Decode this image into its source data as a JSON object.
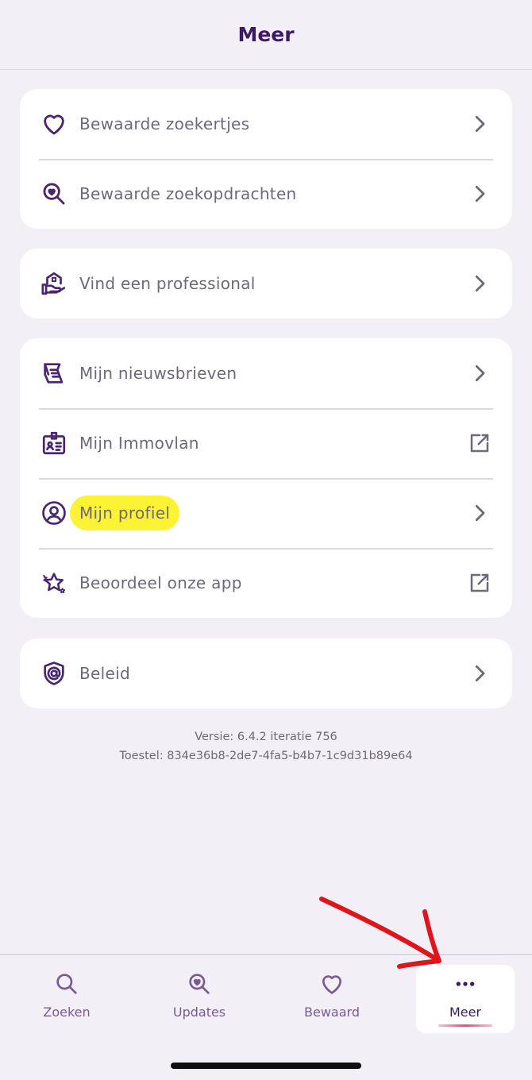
{
  "header": {
    "title": "Meer"
  },
  "menu": {
    "group1": [
      {
        "label": "Bewaarde zoekertjes",
        "icon": "heart-icon",
        "trail": "chevron-right-icon"
      },
      {
        "label": "Bewaarde zoekopdrachten",
        "icon": "search-heart-icon",
        "trail": "chevron-right-icon"
      }
    ],
    "group2": [
      {
        "label": "Vind een professional",
        "icon": "house-hand-icon",
        "trail": "chevron-right-icon"
      }
    ],
    "group3": [
      {
        "label": "Mijn nieuwsbrieven",
        "icon": "newsletter-icon",
        "trail": "chevron-right-icon"
      },
      {
        "label": "Mijn Immovlan",
        "icon": "id-badge-icon",
        "trail": "external-link-icon"
      },
      {
        "label": "Mijn profiel",
        "icon": "user-circle-icon",
        "trail": "chevron-right-icon"
      },
      {
        "label": "Beoordeel onze app",
        "icon": "stars-icon",
        "trail": "external-link-icon"
      }
    ],
    "group4": [
      {
        "label": "Beleid",
        "icon": "shield-at-icon",
        "trail": "chevron-right-icon"
      }
    ]
  },
  "version": {
    "line1": "Versie: 6.4.2 iteratie 756",
    "line2": "Toestel: 834e36b8-2de7-4fa5-b4b7-1c9d31b89e64"
  },
  "tabs": [
    {
      "label": "Zoeken",
      "icon": "search-icon"
    },
    {
      "label": "Updates",
      "icon": "search-heart-icon"
    },
    {
      "label": "Bewaard",
      "icon": "heart-icon"
    },
    {
      "label": "Meer",
      "icon": "more-dots-icon",
      "active": true
    }
  ],
  "colors": {
    "accent": "#3d1a63",
    "icon": "#4a2670",
    "background": "#f3eff6",
    "highlight": "#fbf334",
    "annotation": "#e0151b"
  }
}
